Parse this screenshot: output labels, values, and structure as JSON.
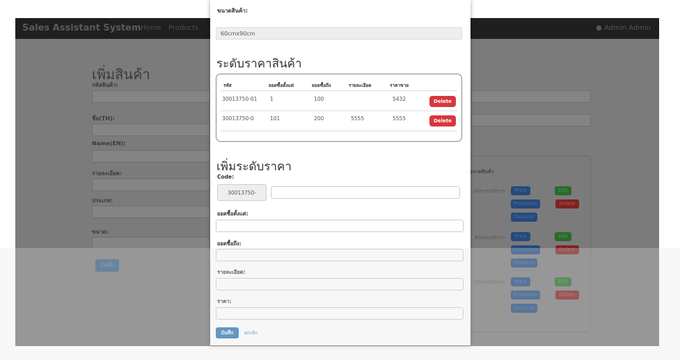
{
  "navbar": {
    "brand": "Sales Assistant System",
    "links": [
      "Home",
      "Products"
    ],
    "user_menu": "Admin Admin"
  },
  "background_form": {
    "title": "เพิ่มสินค้า",
    "fields": [
      "รหัสสินค้า:",
      "ชื่อ(TH):",
      "Name(EN):",
      "รายละเอียด:",
      "ประเภท:",
      "ขนาด:"
    ],
    "save_label": "บันทึก",
    "panel_title": "ขนาดสินค้า",
    "sizes": [
      "60cmx90cm",
      "80cmx90cm",
      "70cmx90cm"
    ],
    "buttons": {
      "price": "Price",
      "edit": "Edit",
      "promotion": "Promotion",
      "delete": "Delete",
      "discount": "Discount"
    }
  },
  "modal": {
    "size_label": "ขนาดสินค้า:",
    "size_value": "60cmx90cm",
    "tiers_title": "ระดับราคาสินค้า",
    "table": {
      "headers": [
        "รหัส",
        "ยอดซื้อตั้งแต่",
        "ยอดซื้อถึง",
        "รายละเอียด",
        "ราคาขาย"
      ],
      "rows": [
        {
          "code": "30013750-01",
          "from": "1",
          "to": "100",
          "detail": "",
          "price": "5432",
          "action": "Delete"
        },
        {
          "code": "30013750-0",
          "from": "101",
          "to": "200",
          "detail": "5555",
          "price": "5555",
          "action": "Delete"
        }
      ]
    },
    "add_title": "เพิ่มระดับราคา",
    "code_label": "Code:",
    "code_prefix": "30013750-",
    "from_label": "ยอดซื้อตั้งแต่:",
    "to_label": "ยอดซื้อถึง:",
    "detail_label": "รายละเอียด:",
    "price_label": "ราคา:",
    "save_label": "บันทึก",
    "cancel_label": "ยกเลิก"
  }
}
